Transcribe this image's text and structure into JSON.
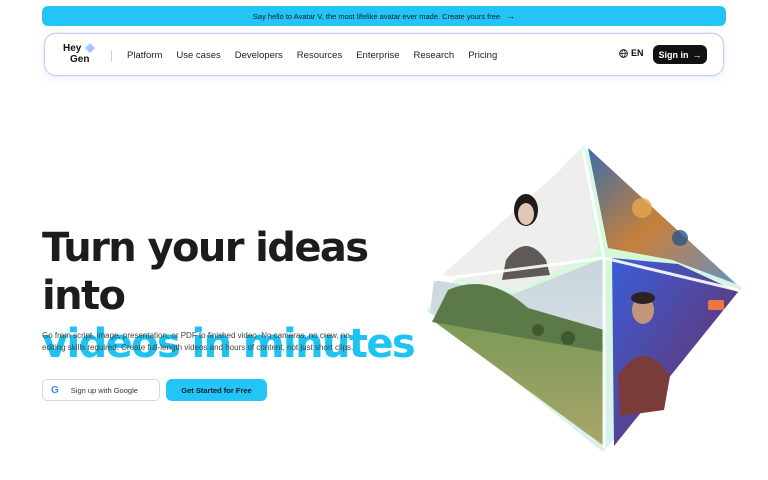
{
  "banner": {
    "text": "Say hello to Avatar V, the most lifelike avatar ever made. Create yours free",
    "icon": "arrow-right-icon"
  },
  "nav": {
    "logo_line1": "Hey",
    "logo_line2": "Gen",
    "links": [
      "Platform",
      "Use cases",
      "Developers",
      "Resources",
      "Enterprise",
      "Research",
      "Pricing"
    ],
    "language": "EN",
    "signin_label": "Sign in"
  },
  "hero": {
    "headline_line1": "Turn your ideas into",
    "headline_line2": "videos in minutes",
    "subtext": "Go from script, image, presentation, or PDF to finished video. No cameras, no crew, no editing skills required. Create full-length videos and hours of content, not just short clips.",
    "google_button_label": "Sign up with Google",
    "cta_button_label": "Get Started for Free"
  },
  "colors": {
    "accent": "#22c5f5",
    "headline_dark": "#1c1c1c",
    "headline_accent": "#1ec3f2",
    "signin_bg": "#111111"
  }
}
